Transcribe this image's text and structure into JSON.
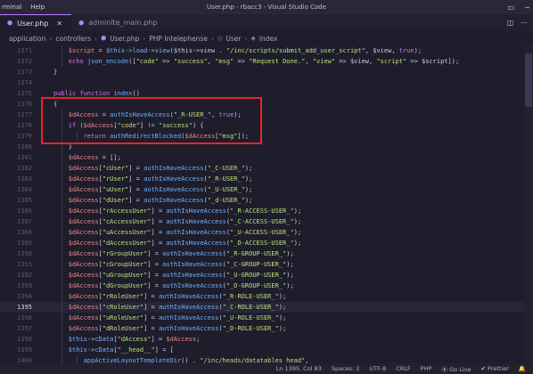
{
  "titlebar": {
    "menu": [
      "rminal",
      "Help"
    ],
    "window_title": "User.php - rbacc3 - Visual Studio Code"
  },
  "tabs": [
    {
      "label": "User.php",
      "active": true,
      "icon": "php-icon"
    },
    {
      "label": "adminlte_main.php",
      "active": false,
      "icon": "php-icon"
    }
  ],
  "breadcrumb": [
    "application",
    "controllers",
    "User.php",
    "PHP Intelephense",
    "User",
    "index"
  ],
  "editor": {
    "current_line": 1395,
    "lines": [
      {
        "n": 1371,
        "indent": 2,
        "tokens": [
          [
            "var",
            "$script"
          ],
          [
            "pu",
            " = "
          ],
          [
            "fn",
            "$this"
          ],
          [
            "op",
            "->"
          ],
          [
            "fn",
            "load"
          ],
          [
            "op",
            "->"
          ],
          [
            "fn",
            "view"
          ],
          [
            "pu",
            "($this->view"
          ],
          [
            "pu",
            " . "
          ],
          [
            "str",
            "\"/inc/scripts/submit_add_user_script\""
          ],
          [
            "pu",
            ", $view, "
          ],
          [
            "kw",
            "true"
          ],
          [
            "pu",
            ");"
          ]
        ]
      },
      {
        "n": 1372,
        "indent": 2,
        "tokens": [
          [
            "kw",
            "echo "
          ],
          [
            "fn",
            "json_encode"
          ],
          [
            "pu",
            "(["
          ],
          [
            "str",
            "\"code\""
          ],
          [
            "pu",
            " => "
          ],
          [
            "str",
            "\"success\""
          ],
          [
            "pu",
            ", "
          ],
          [
            "str",
            "\"msg\""
          ],
          [
            "pu",
            " => "
          ],
          [
            "str",
            "\"Request Done.\""
          ],
          [
            "pu",
            ", "
          ],
          [
            "str",
            "\"view\""
          ],
          [
            "pu",
            " => $view, "
          ],
          [
            "str",
            "\"script\""
          ],
          [
            "pu",
            " => $script]);"
          ]
        ]
      },
      {
        "n": 1373,
        "indent": 1,
        "tokens": [
          [
            "pu",
            "}"
          ]
        ]
      },
      {
        "n": 1374,
        "indent": 0,
        "tokens": []
      },
      {
        "n": 1375,
        "indent": 1,
        "tokens": [
          [
            "kw",
            "public function "
          ],
          [
            "fn",
            "index"
          ],
          [
            "pu",
            "()"
          ]
        ]
      },
      {
        "n": 1376,
        "indent": 1,
        "tokens": [
          [
            "pu",
            "{"
          ]
        ]
      },
      {
        "n": 1377,
        "indent": 2,
        "tokens": [
          [
            "var",
            "$dAccess"
          ],
          [
            "pu",
            " = "
          ],
          [
            "fn",
            "authIsHaveAccess"
          ],
          [
            "pu",
            "("
          ],
          [
            "str",
            "\"_R-USER_\""
          ],
          [
            "pu",
            ", "
          ],
          [
            "kw",
            "true"
          ],
          [
            "pu",
            ");"
          ]
        ]
      },
      {
        "n": 1378,
        "indent": 2,
        "tokens": [
          [
            "kw",
            "if "
          ],
          [
            "pu",
            "("
          ],
          [
            "var",
            "$dAccess"
          ],
          [
            "pu",
            "["
          ],
          [
            "str",
            "\"code\""
          ],
          [
            "pu",
            "] "
          ],
          [
            "op",
            "!="
          ],
          [
            "pu",
            " "
          ],
          [
            "str",
            "\"success\""
          ],
          [
            "pu",
            ") {"
          ]
        ]
      },
      {
        "n": 1379,
        "indent": 3,
        "tokens": [
          [
            "kw",
            "return "
          ],
          [
            "fn",
            "authRedirectBlocked"
          ],
          [
            "pu",
            "("
          ],
          [
            "var",
            "$dAccess"
          ],
          [
            "pu",
            "["
          ],
          [
            "str",
            "\"msg\""
          ],
          [
            "pu",
            "]);"
          ]
        ]
      },
      {
        "n": 1380,
        "indent": 2,
        "tokens": [
          [
            "pu",
            "}"
          ]
        ]
      },
      {
        "n": 1381,
        "indent": 2,
        "tokens": [
          [
            "var",
            "$dAccess"
          ],
          [
            "pu",
            " = [];"
          ]
        ]
      },
      {
        "n": 1382,
        "indent": 2,
        "tokens": [
          [
            "var",
            "$dAccess"
          ],
          [
            "pu",
            "["
          ],
          [
            "str",
            "\"cUser\""
          ],
          [
            "pu",
            "] = "
          ],
          [
            "fn",
            "authIsHaveAccess"
          ],
          [
            "pu",
            "("
          ],
          [
            "str",
            "\"_C-USER_\""
          ],
          [
            "pu",
            ");"
          ]
        ]
      },
      {
        "n": 1383,
        "indent": 2,
        "tokens": [
          [
            "var",
            "$dAccess"
          ],
          [
            "pu",
            "["
          ],
          [
            "str",
            "\"rUser\""
          ],
          [
            "pu",
            "] = "
          ],
          [
            "fn",
            "authIsHaveAccess"
          ],
          [
            "pu",
            "("
          ],
          [
            "str",
            "\"_R-USER_\""
          ],
          [
            "pu",
            ");"
          ]
        ]
      },
      {
        "n": 1384,
        "indent": 2,
        "tokens": [
          [
            "var",
            "$dAccess"
          ],
          [
            "pu",
            "["
          ],
          [
            "str",
            "\"uUser\""
          ],
          [
            "pu",
            "] = "
          ],
          [
            "fn",
            "authIsHaveAccess"
          ],
          [
            "pu",
            "("
          ],
          [
            "str",
            "\"_U-USER_\""
          ],
          [
            "pu",
            ");"
          ]
        ]
      },
      {
        "n": 1385,
        "indent": 2,
        "tokens": [
          [
            "var",
            "$dAccess"
          ],
          [
            "pu",
            "["
          ],
          [
            "str",
            "\"dUser\""
          ],
          [
            "pu",
            "] = "
          ],
          [
            "fn",
            "authIsHaveAccess"
          ],
          [
            "pu",
            "("
          ],
          [
            "str",
            "\"_d-USER_\""
          ],
          [
            "pu",
            ");"
          ]
        ]
      },
      {
        "n": 1386,
        "indent": 2,
        "tokens": [
          [
            "var",
            "$dAccess"
          ],
          [
            "pu",
            "["
          ],
          [
            "str",
            "\"rAccessUser\""
          ],
          [
            "pu",
            "] = "
          ],
          [
            "fn",
            "authIsHaveAccess"
          ],
          [
            "pu",
            "("
          ],
          [
            "str",
            "\"_R-ACCESS-USER_\""
          ],
          [
            "pu",
            ");"
          ]
        ]
      },
      {
        "n": 1387,
        "indent": 2,
        "tokens": [
          [
            "var",
            "$dAccess"
          ],
          [
            "pu",
            "["
          ],
          [
            "str",
            "\"cAccessUser\""
          ],
          [
            "pu",
            "] = "
          ],
          [
            "fn",
            "authIsHaveAccess"
          ],
          [
            "pu",
            "("
          ],
          [
            "str",
            "\"_C-ACCESS-USER_\""
          ],
          [
            "pu",
            ");"
          ]
        ]
      },
      {
        "n": 1388,
        "indent": 2,
        "tokens": [
          [
            "var",
            "$dAccess"
          ],
          [
            "pu",
            "["
          ],
          [
            "str",
            "\"uAccessUser\""
          ],
          [
            "pu",
            "] = "
          ],
          [
            "fn",
            "authIsHaveAccess"
          ],
          [
            "pu",
            "("
          ],
          [
            "str",
            "\"_U-ACCESS-USER_\""
          ],
          [
            "pu",
            ");"
          ]
        ]
      },
      {
        "n": 1389,
        "indent": 2,
        "tokens": [
          [
            "var",
            "$dAccess"
          ],
          [
            "pu",
            "["
          ],
          [
            "str",
            "\"dAccessUser\""
          ],
          [
            "pu",
            "] = "
          ],
          [
            "fn",
            "authIsHaveAccess"
          ],
          [
            "pu",
            "("
          ],
          [
            "str",
            "\"_D-ACCESS-USER_\""
          ],
          [
            "pu",
            ");"
          ]
        ]
      },
      {
        "n": 1390,
        "indent": 2,
        "tokens": [
          [
            "var",
            "$dAccess"
          ],
          [
            "pu",
            "["
          ],
          [
            "str",
            "\"rGroupUser\""
          ],
          [
            "pu",
            "] = "
          ],
          [
            "fn",
            "authIsHaveAccess"
          ],
          [
            "pu",
            "("
          ],
          [
            "str",
            "\"_R-GROUP-USER_\""
          ],
          [
            "pu",
            ");"
          ]
        ]
      },
      {
        "n": 1391,
        "indent": 2,
        "tokens": [
          [
            "var",
            "$dAccess"
          ],
          [
            "pu",
            "["
          ],
          [
            "str",
            "\"cGroupUser\""
          ],
          [
            "pu",
            "] = "
          ],
          [
            "fn",
            "authIsHaveAccess"
          ],
          [
            "pu",
            "("
          ],
          [
            "str",
            "\"_C-GROUP-USER_\""
          ],
          [
            "pu",
            ");"
          ]
        ]
      },
      {
        "n": 1392,
        "indent": 2,
        "tokens": [
          [
            "var",
            "$dAccess"
          ],
          [
            "pu",
            "["
          ],
          [
            "str",
            "\"uGroupUser\""
          ],
          [
            "pu",
            "] = "
          ],
          [
            "fn",
            "authIsHaveAccess"
          ],
          [
            "pu",
            "("
          ],
          [
            "str",
            "\"_U-GROUP-USER_\""
          ],
          [
            "pu",
            ");"
          ]
        ]
      },
      {
        "n": 1393,
        "indent": 2,
        "tokens": [
          [
            "var",
            "$dAccess"
          ],
          [
            "pu",
            "["
          ],
          [
            "str",
            "\"dGroupUser\""
          ],
          [
            "pu",
            "] = "
          ],
          [
            "fn",
            "authIsHaveAccess"
          ],
          [
            "pu",
            "("
          ],
          [
            "str",
            "\"_D-GROUP-USER_\""
          ],
          [
            "pu",
            ");"
          ]
        ]
      },
      {
        "n": 1394,
        "indent": 2,
        "tokens": [
          [
            "var",
            "$dAccess"
          ],
          [
            "pu",
            "["
          ],
          [
            "str",
            "\"rRoleUser\""
          ],
          [
            "pu",
            "] = "
          ],
          [
            "fn",
            "authIsHaveAccess"
          ],
          [
            "pu",
            "("
          ],
          [
            "str",
            "\"_R-ROLE-USER_\""
          ],
          [
            "pu",
            ");"
          ]
        ]
      },
      {
        "n": 1395,
        "indent": 2,
        "tokens": [
          [
            "var",
            "$dAccess"
          ],
          [
            "pu",
            "["
          ],
          [
            "str",
            "\"cRoleUser\""
          ],
          [
            "pu",
            "] = "
          ],
          [
            "fn",
            "authIsHaveAccess"
          ],
          [
            "pu",
            "("
          ],
          [
            "str",
            "\"_C-ROLE-USER_\""
          ],
          [
            "pu",
            ");"
          ]
        ]
      },
      {
        "n": 1396,
        "indent": 2,
        "tokens": [
          [
            "var",
            "$dAccess"
          ],
          [
            "pu",
            "["
          ],
          [
            "str",
            "\"uRoleUser\""
          ],
          [
            "pu",
            "] = "
          ],
          [
            "fn",
            "authIsHaveAccess"
          ],
          [
            "pu",
            "("
          ],
          [
            "str",
            "\"_U-ROLE-USER_\""
          ],
          [
            "pu",
            ");"
          ]
        ]
      },
      {
        "n": 1397,
        "indent": 2,
        "tokens": [
          [
            "var",
            "$dAccess"
          ],
          [
            "pu",
            "["
          ],
          [
            "str",
            "\"dRoleUser\""
          ],
          [
            "pu",
            "] = "
          ],
          [
            "fn",
            "authIsHaveAccess"
          ],
          [
            "pu",
            "("
          ],
          [
            "str",
            "\"_D-ROLE-USER_\""
          ],
          [
            "pu",
            ");"
          ]
        ]
      },
      {
        "n": 1398,
        "indent": 2,
        "tokens": [
          [
            "fn",
            "$this"
          ],
          [
            "op",
            "->"
          ],
          [
            "fn",
            "cData"
          ],
          [
            "pu",
            "["
          ],
          [
            "str",
            "\"dAccess\""
          ],
          [
            "pu",
            "] = "
          ],
          [
            "var",
            "$dAccess"
          ],
          [
            "pu",
            ";"
          ]
        ]
      },
      {
        "n": 1399,
        "indent": 2,
        "tokens": [
          [
            "fn",
            "$this"
          ],
          [
            "op",
            "->"
          ],
          [
            "fn",
            "cData"
          ],
          [
            "pu",
            "["
          ],
          [
            "str",
            "\"__head__\""
          ],
          [
            "pu",
            "] = ["
          ]
        ]
      },
      {
        "n": 1400,
        "indent": 3,
        "tokens": [
          [
            "fn",
            "appActiveLayoutTemplateDir"
          ],
          [
            "pu",
            "() . "
          ],
          [
            "str",
            "\"/inc/heads/datatables_head\""
          ],
          [
            "pu",
            ","
          ]
        ]
      },
      {
        "n": 1401,
        "indent": 2,
        "tokens": [
          [
            "pu",
            "];"
          ]
        ]
      },
      {
        "n": 1402,
        "indent": 2,
        "tokens": [
          [
            "fn",
            "$this"
          ],
          [
            "op",
            "->"
          ],
          [
            "fn",
            "cData"
          ],
          [
            "pu",
            "["
          ],
          [
            "str",
            "\"__content_header__\""
          ],
          [
            "pu",
            "] = ["
          ]
        ]
      }
    ]
  },
  "statusbar": {
    "position": "Ln 1395, Col 83",
    "spaces": "Spaces: 2",
    "encoding": "UTF-8",
    "eol": "CRLF",
    "language": "PHP",
    "golive": "Go Live",
    "prettier": "Prettier"
  },
  "colors": {
    "background": "#1f1d2b",
    "highlight_box": "#e8242a",
    "keyword": "#c87be8",
    "function": "#6fb2ff",
    "variable": "#ee8a8a",
    "string": "#b9e07a"
  }
}
